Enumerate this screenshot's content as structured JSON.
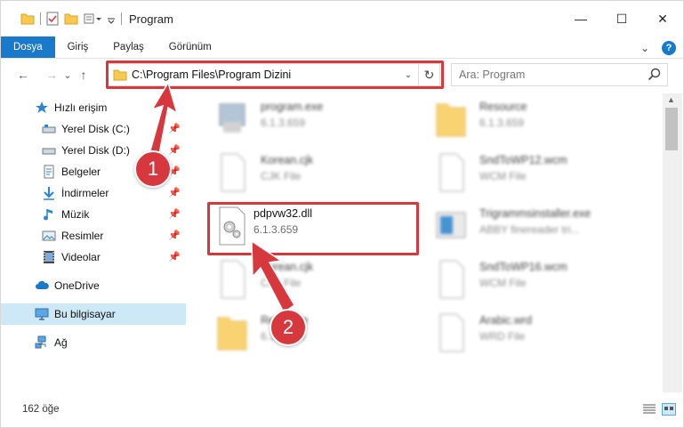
{
  "window": {
    "title": "Program",
    "controls": {
      "minimize": "—",
      "maximize": "☐",
      "close": "✕"
    }
  },
  "ribbon": {
    "tabs": [
      "Dosya",
      "Giriş",
      "Paylaş",
      "Görünüm"
    ],
    "active_tab": "Dosya",
    "expand_glyph": "⌄",
    "help_glyph": "?"
  },
  "nav": {
    "back": "←",
    "forward": "→",
    "recent": "⌄",
    "up": "↑"
  },
  "address": {
    "path": "C:\\Program Files\\Program Dizini",
    "dropdown_glyph": "⌄",
    "refresh_glyph": "↻"
  },
  "search": {
    "placeholder": "Ara: Program"
  },
  "sidebar": {
    "items": [
      {
        "label": "Hızlı erişim",
        "icon": "star-icon",
        "pinned": false
      },
      {
        "label": "Yerel Disk (C:)",
        "icon": "drive-icon",
        "pinned": true
      },
      {
        "label": "Yerel Disk (D:)",
        "icon": "drive-icon",
        "pinned": true
      },
      {
        "label": "Belgeler",
        "icon": "documents-icon",
        "pinned": true
      },
      {
        "label": "İndirmeler",
        "icon": "download-icon",
        "pinned": true
      },
      {
        "label": "Müzik",
        "icon": "music-icon",
        "pinned": true
      },
      {
        "label": "Resimler",
        "icon": "pictures-icon",
        "pinned": true
      },
      {
        "label": "Videolar",
        "icon": "video-icon",
        "pinned": true
      },
      {
        "label": "OneDrive",
        "icon": "cloud-icon",
        "pinned": false
      },
      {
        "label": "Bu bilgisayar",
        "icon": "computer-icon",
        "pinned": false
      },
      {
        "label": "Ağ",
        "icon": "network-icon",
        "pinned": false
      }
    ],
    "pin_glyph": "📌"
  },
  "files": [
    {
      "name": "program.exe",
      "sub": "6.1.3.659",
      "icon": "exe-icon"
    },
    {
      "name": "Resource",
      "sub": "6.1.3.659",
      "icon": "folder-icon"
    },
    {
      "name": "Korean.cjk",
      "sub": "CJK File",
      "icon": "file-icon"
    },
    {
      "name": "SndToWP12.wcm",
      "sub": "WCM File",
      "icon": "file-icon"
    },
    {
      "name": "pdpvw32.dll",
      "sub": "6.1.3.659",
      "icon": "dll-gear-icon"
    },
    {
      "name": "Trigrammsinstaller.exe",
      "sub": "ABBY finereader tri...",
      "icon": "installer-icon"
    },
    {
      "name": "Korean.cjk",
      "sub": "CJK File",
      "icon": "file-icon"
    },
    {
      "name": "SndToWP16.wcm",
      "sub": "WCM File",
      "icon": "file-icon"
    },
    {
      "name": "Resource",
      "sub": "6.1.3.659",
      "icon": "folder-icon"
    },
    {
      "name": "Arabic.wrd",
      "sub": "WRD File",
      "icon": "file-icon"
    }
  ],
  "callouts": [
    "1",
    "2"
  ],
  "status": {
    "count": "162 öğe"
  },
  "colors": {
    "accent": "#1979ca",
    "highlight": "#d6383e",
    "selected": "#cde8f7",
    "folder": "#f8c94f"
  }
}
